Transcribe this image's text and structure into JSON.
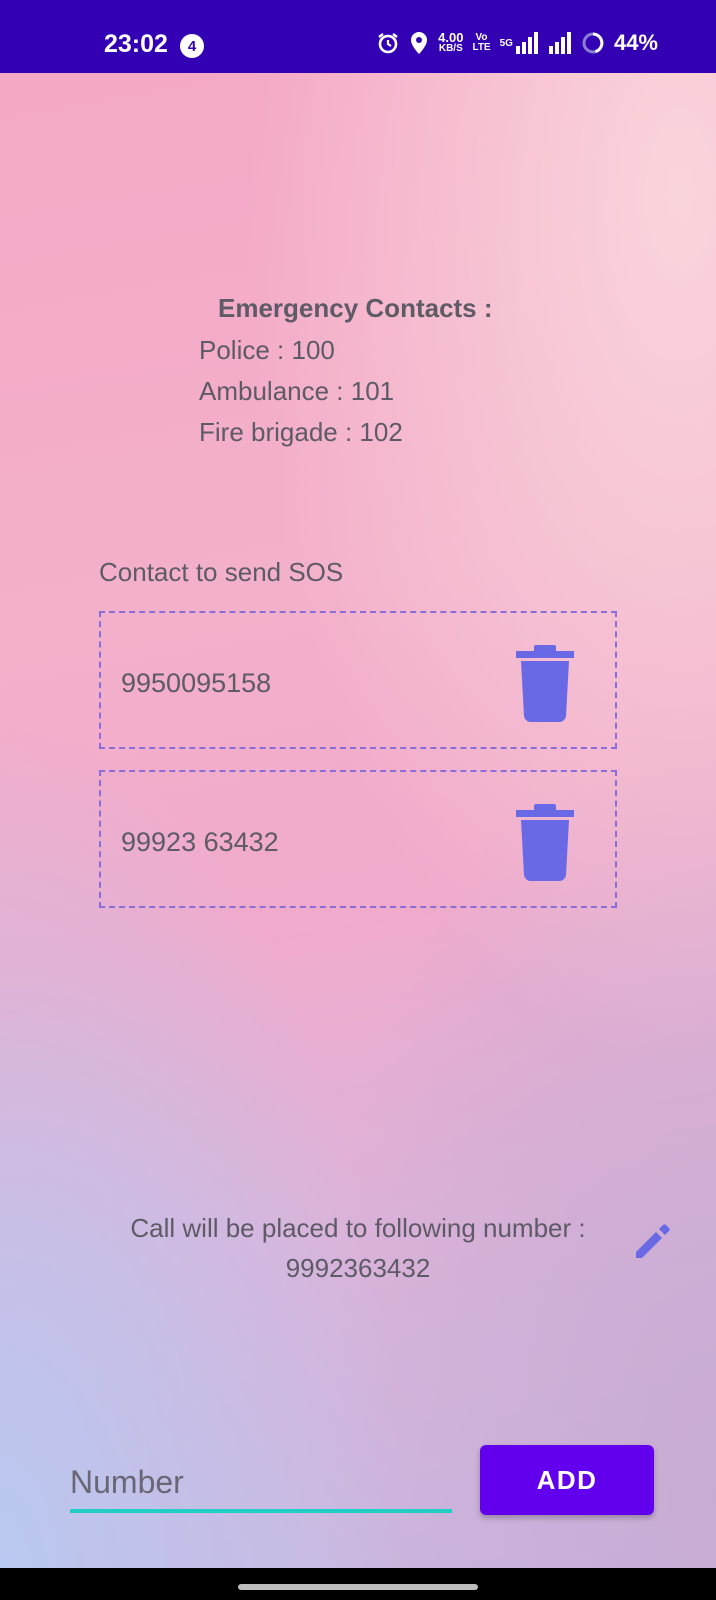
{
  "status_bar": {
    "time": "23:02",
    "notification_count": "4",
    "net_speed_value": "4.00",
    "net_speed_unit": "KB/S",
    "volte_top": "Vo",
    "volte_bottom": "LTE",
    "network_5g": "5G",
    "battery": "44%"
  },
  "emergency": {
    "title": "Emergency Contacts :",
    "lines": [
      "Police : 100",
      "Ambulance : 101",
      "Fire brigade : 102"
    ]
  },
  "sos": {
    "label": "Contact to send SOS",
    "contacts": [
      {
        "number": "9950095158"
      },
      {
        "number": "99923 63432"
      }
    ]
  },
  "call": {
    "text": "Call will be placed to following number :",
    "number": "9992363432"
  },
  "input": {
    "placeholder": "Number",
    "value": ""
  },
  "add_button": {
    "label": "ADD"
  },
  "colors": {
    "status_bar": "#3300b3",
    "accent": "#6200ee",
    "icon": "#6969e6",
    "underline": "#22cdc5",
    "dashed_border": "#8a6ed8",
    "text": "#5e5a66"
  }
}
